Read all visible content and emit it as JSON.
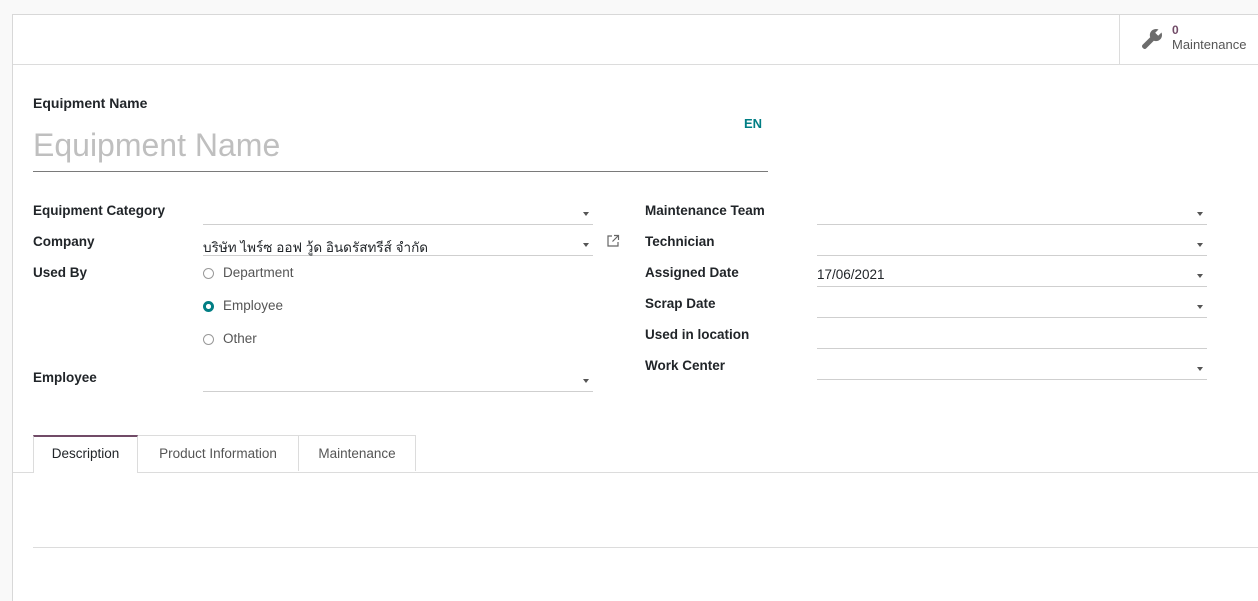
{
  "smart_button": {
    "count": "0",
    "label": "Maintenance",
    "icon": "wrench-icon",
    "count_color": "#714B67"
  },
  "title": {
    "label": "Equipment Name",
    "placeholder": "Equipment Name",
    "lang": "EN"
  },
  "left_fields": {
    "category_label": "Equipment Category",
    "category_value": "",
    "company_label": "Company",
    "company_value": "บริษัท ไพร์ซ ออฟ วู้ด อินดรัสทรีส์ จำกัด",
    "used_by_label": "Used By",
    "used_by_options": [
      "Department",
      "Employee",
      "Other"
    ],
    "used_by_selected": "Employee",
    "employee_label": "Employee",
    "employee_value": ""
  },
  "right_fields": {
    "team_label": "Maintenance Team",
    "team_value": "",
    "technician_label": "Technician",
    "technician_value": "",
    "assigned_label": "Assigned Date",
    "assigned_value": "17/06/2021",
    "scrap_label": "Scrap Date",
    "scrap_value": "",
    "location_label": "Used in location",
    "location_value": "",
    "workcenter_label": "Work Center",
    "workcenter_value": ""
  },
  "tabs": [
    "Description",
    "Product Information",
    "Maintenance"
  ],
  "active_tab": "Description",
  "colors": {
    "accent": "#714B67",
    "teal": "#017e84"
  }
}
